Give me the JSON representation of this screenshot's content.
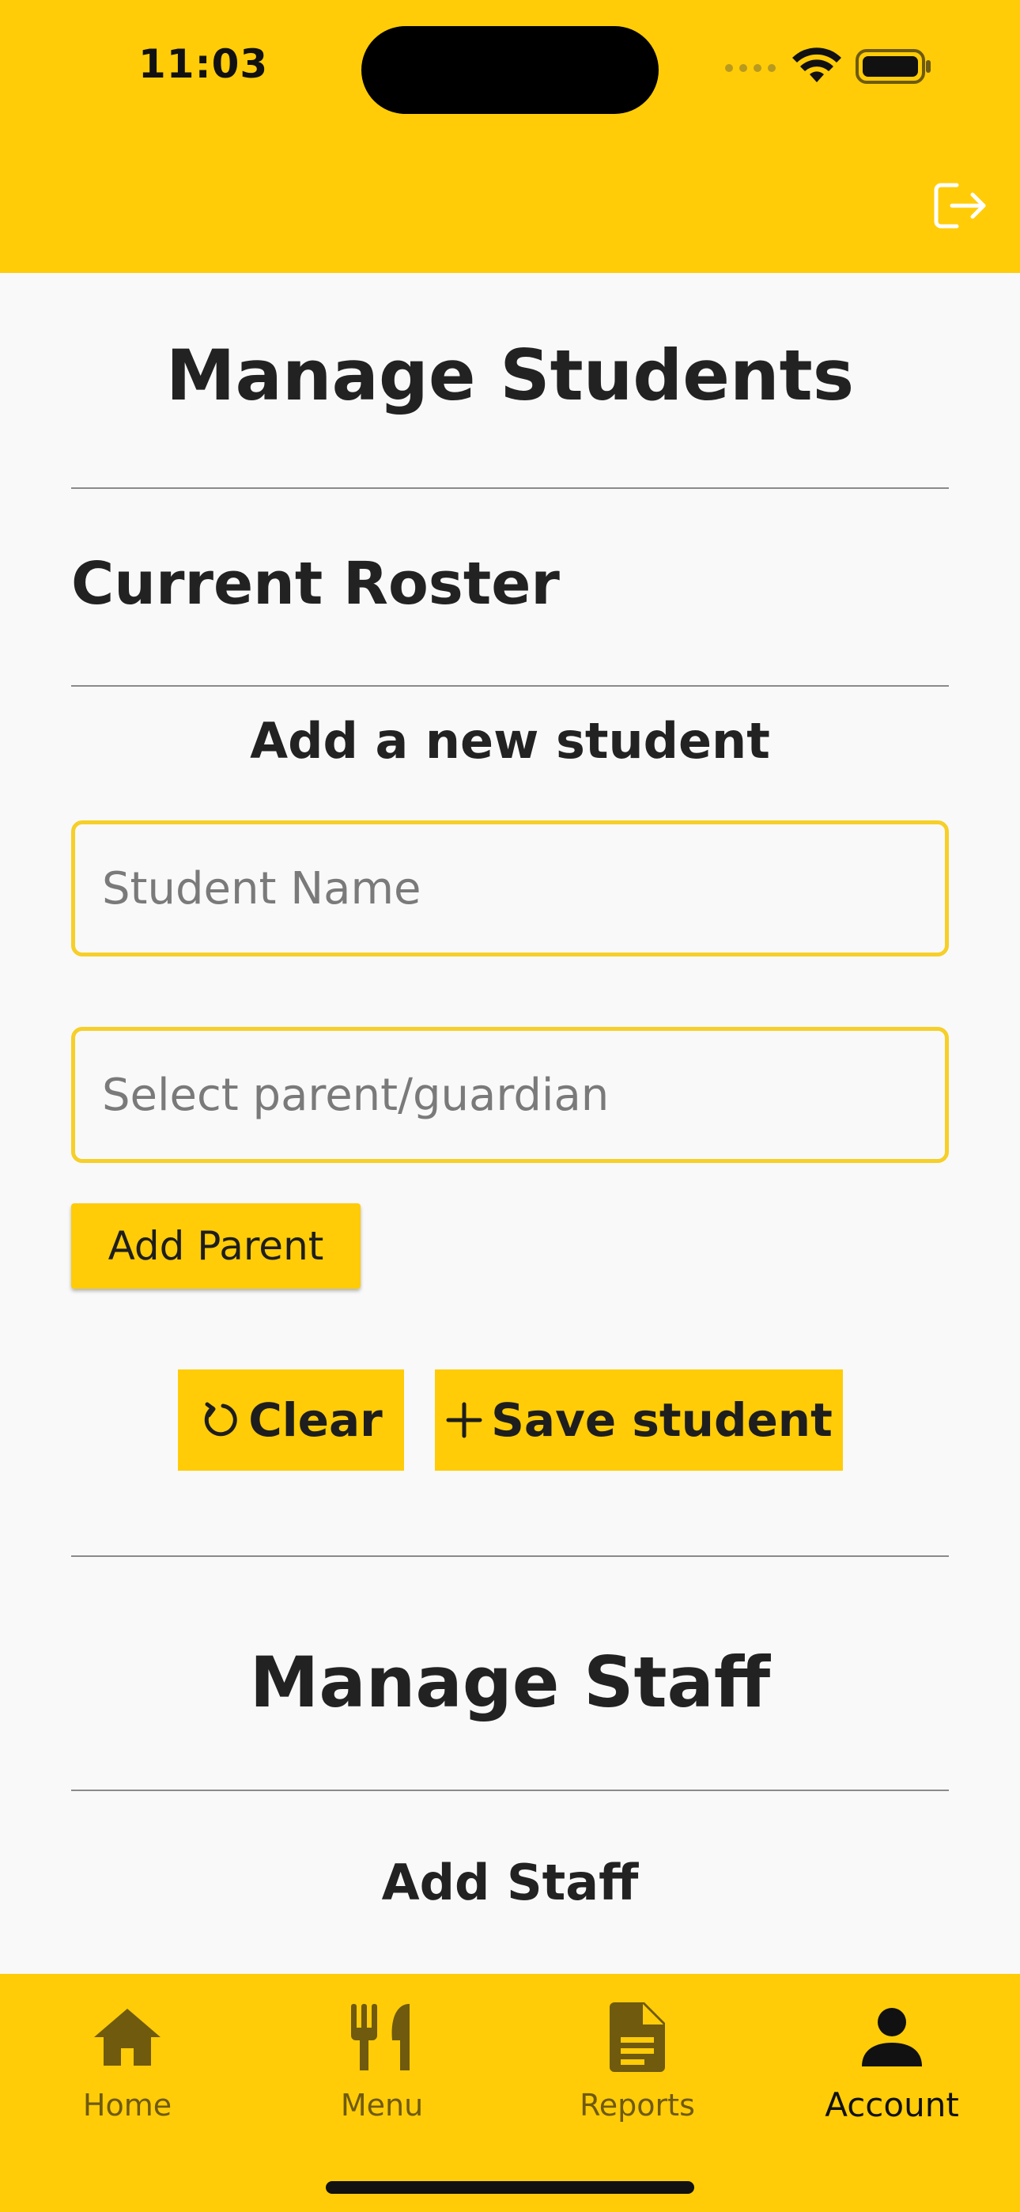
{
  "status_bar": {
    "time": "11:03"
  },
  "header": {
    "logout_icon": "logout-icon"
  },
  "main": {
    "title": "Manage Students",
    "roster_title": "Current Roster",
    "add_student_title": "Add a new student",
    "student_name_placeholder": "Student Name",
    "parent_select_placeholder": "Select parent/guardian",
    "add_parent_label": "Add Parent",
    "clear_label": "Clear",
    "clear_icon": "refresh-icon",
    "save_label": "Save student",
    "save_icon": "plus-icon",
    "staff_title": "Manage Staff",
    "add_staff_title": "Add Staff"
  },
  "bottom_nav": {
    "items": [
      {
        "label": "Home",
        "icon": "home-icon",
        "active": false
      },
      {
        "label": "Menu",
        "icon": "utensils-icon",
        "active": false
      },
      {
        "label": "Reports",
        "icon": "document-icon",
        "active": false
      },
      {
        "label": "Account",
        "icon": "person-icon",
        "active": true
      }
    ]
  },
  "colors": {
    "accent": "#ffcc07",
    "field_border": "#f6cf28",
    "background": "#f9f9f9",
    "text": "#222222",
    "nav_inactive": "#6f5a0e"
  }
}
